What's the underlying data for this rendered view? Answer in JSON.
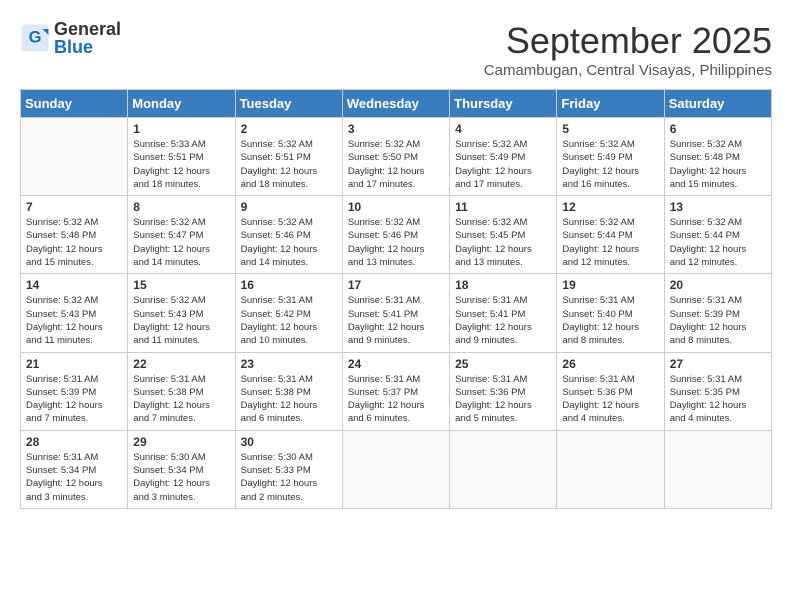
{
  "header": {
    "logo": {
      "general": "General",
      "blue": "Blue"
    },
    "month_title": "September 2025",
    "subtitle": "Camambugan, Central Visayas, Philippines"
  },
  "weekdays": [
    "Sunday",
    "Monday",
    "Tuesday",
    "Wednesday",
    "Thursday",
    "Friday",
    "Saturday"
  ],
  "weeks": [
    [
      {
        "day": "",
        "info": ""
      },
      {
        "day": "1",
        "info": "Sunrise: 5:33 AM\nSunset: 5:51 PM\nDaylight: 12 hours\nand 18 minutes."
      },
      {
        "day": "2",
        "info": "Sunrise: 5:32 AM\nSunset: 5:51 PM\nDaylight: 12 hours\nand 18 minutes."
      },
      {
        "day": "3",
        "info": "Sunrise: 5:32 AM\nSunset: 5:50 PM\nDaylight: 12 hours\nand 17 minutes."
      },
      {
        "day": "4",
        "info": "Sunrise: 5:32 AM\nSunset: 5:49 PM\nDaylight: 12 hours\nand 17 minutes."
      },
      {
        "day": "5",
        "info": "Sunrise: 5:32 AM\nSunset: 5:49 PM\nDaylight: 12 hours\nand 16 minutes."
      },
      {
        "day": "6",
        "info": "Sunrise: 5:32 AM\nSunset: 5:48 PM\nDaylight: 12 hours\nand 15 minutes."
      }
    ],
    [
      {
        "day": "7",
        "info": "Sunrise: 5:32 AM\nSunset: 5:48 PM\nDaylight: 12 hours\nand 15 minutes."
      },
      {
        "day": "8",
        "info": "Sunrise: 5:32 AM\nSunset: 5:47 PM\nDaylight: 12 hours\nand 14 minutes."
      },
      {
        "day": "9",
        "info": "Sunrise: 5:32 AM\nSunset: 5:46 PM\nDaylight: 12 hours\nand 14 minutes."
      },
      {
        "day": "10",
        "info": "Sunrise: 5:32 AM\nSunset: 5:46 PM\nDaylight: 12 hours\nand 13 minutes."
      },
      {
        "day": "11",
        "info": "Sunrise: 5:32 AM\nSunset: 5:45 PM\nDaylight: 12 hours\nand 13 minutes."
      },
      {
        "day": "12",
        "info": "Sunrise: 5:32 AM\nSunset: 5:44 PM\nDaylight: 12 hours\nand 12 minutes."
      },
      {
        "day": "13",
        "info": "Sunrise: 5:32 AM\nSunset: 5:44 PM\nDaylight: 12 hours\nand 12 minutes."
      }
    ],
    [
      {
        "day": "14",
        "info": "Sunrise: 5:32 AM\nSunset: 5:43 PM\nDaylight: 12 hours\nand 11 minutes."
      },
      {
        "day": "15",
        "info": "Sunrise: 5:32 AM\nSunset: 5:43 PM\nDaylight: 12 hours\nand 11 minutes."
      },
      {
        "day": "16",
        "info": "Sunrise: 5:31 AM\nSunset: 5:42 PM\nDaylight: 12 hours\nand 10 minutes."
      },
      {
        "day": "17",
        "info": "Sunrise: 5:31 AM\nSunset: 5:41 PM\nDaylight: 12 hours\nand 9 minutes."
      },
      {
        "day": "18",
        "info": "Sunrise: 5:31 AM\nSunset: 5:41 PM\nDaylight: 12 hours\nand 9 minutes."
      },
      {
        "day": "19",
        "info": "Sunrise: 5:31 AM\nSunset: 5:40 PM\nDaylight: 12 hours\nand 8 minutes."
      },
      {
        "day": "20",
        "info": "Sunrise: 5:31 AM\nSunset: 5:39 PM\nDaylight: 12 hours\nand 8 minutes."
      }
    ],
    [
      {
        "day": "21",
        "info": "Sunrise: 5:31 AM\nSunset: 5:39 PM\nDaylight: 12 hours\nand 7 minutes."
      },
      {
        "day": "22",
        "info": "Sunrise: 5:31 AM\nSunset: 5:38 PM\nDaylight: 12 hours\nand 7 minutes."
      },
      {
        "day": "23",
        "info": "Sunrise: 5:31 AM\nSunset: 5:38 PM\nDaylight: 12 hours\nand 6 minutes."
      },
      {
        "day": "24",
        "info": "Sunrise: 5:31 AM\nSunset: 5:37 PM\nDaylight: 12 hours\nand 6 minutes."
      },
      {
        "day": "25",
        "info": "Sunrise: 5:31 AM\nSunset: 5:36 PM\nDaylight: 12 hours\nand 5 minutes."
      },
      {
        "day": "26",
        "info": "Sunrise: 5:31 AM\nSunset: 5:36 PM\nDaylight: 12 hours\nand 4 minutes."
      },
      {
        "day": "27",
        "info": "Sunrise: 5:31 AM\nSunset: 5:35 PM\nDaylight: 12 hours\nand 4 minutes."
      }
    ],
    [
      {
        "day": "28",
        "info": "Sunrise: 5:31 AM\nSunset: 5:34 PM\nDaylight: 12 hours\nand 3 minutes."
      },
      {
        "day": "29",
        "info": "Sunrise: 5:30 AM\nSunset: 5:34 PM\nDaylight: 12 hours\nand 3 minutes."
      },
      {
        "day": "30",
        "info": "Sunrise: 5:30 AM\nSunset: 5:33 PM\nDaylight: 12 hours\nand 2 minutes."
      },
      {
        "day": "",
        "info": ""
      },
      {
        "day": "",
        "info": ""
      },
      {
        "day": "",
        "info": ""
      },
      {
        "day": "",
        "info": ""
      }
    ]
  ]
}
